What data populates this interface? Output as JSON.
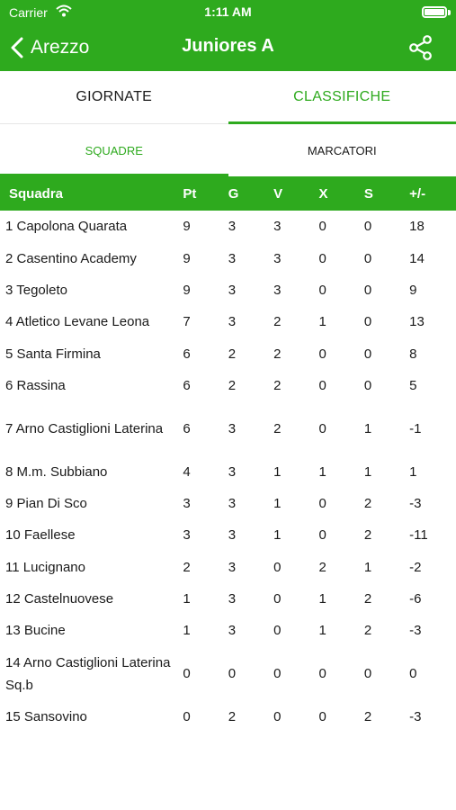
{
  "colors": {
    "accent": "#2eaa1e",
    "text": "#1a1a1a",
    "background": "#ffffff"
  },
  "status": {
    "carrier": "Carrier",
    "time": "1:11 AM"
  },
  "nav": {
    "back_label": "Arezzo",
    "title": "Juniores A",
    "share_icon": "share-icon",
    "back_icon": "chevron-left-icon"
  },
  "tabs": [
    {
      "label": "GIORNATE",
      "active": false
    },
    {
      "label": "CLASSIFICHE",
      "active": true
    }
  ],
  "subtabs": [
    {
      "label": "SQUADRE",
      "active": true
    },
    {
      "label": "MARCATORI",
      "active": false
    }
  ],
  "table": {
    "headers": [
      "Squadra",
      "Pt",
      "G",
      "V",
      "X",
      "S",
      "+/-"
    ],
    "rows": [
      {
        "team": "1  Capolona Quarata",
        "pt": "9",
        "g": "3",
        "v": "3",
        "x": "0",
        "s": "0",
        "diff": "18"
      },
      {
        "team": "2  Casentino Academy",
        "pt": "9",
        "g": "3",
        "v": "3",
        "x": "0",
        "s": "0",
        "diff": "14"
      },
      {
        "team": "3  Tegoleto",
        "pt": "9",
        "g": "3",
        "v": "3",
        "x": "0",
        "s": "0",
        "diff": "9"
      },
      {
        "team": "4  Atletico Levane Leona",
        "pt": "7",
        "g": "3",
        "v": "2",
        "x": "1",
        "s": "0",
        "diff": "13"
      },
      {
        "team": "5  Santa Firmina",
        "pt": "6",
        "g": "2",
        "v": "2",
        "x": "0",
        "s": "0",
        "diff": "8"
      },
      {
        "team": "6  Rassina",
        "pt": "6",
        "g": "2",
        "v": "2",
        "x": "0",
        "s": "0",
        "diff": "5"
      },
      {
        "team": "7  Arno Castiglioni Laterina",
        "pt": "6",
        "g": "3",
        "v": "2",
        "x": "0",
        "s": "1",
        "diff": "-1"
      },
      {
        "team": "8  M.m. Subbiano",
        "pt": "4",
        "g": "3",
        "v": "1",
        "x": "1",
        "s": "1",
        "diff": "1"
      },
      {
        "team": "9  Pian Di Sco",
        "pt": "3",
        "g": "3",
        "v": "1",
        "x": "0",
        "s": "2",
        "diff": "-3"
      },
      {
        "team": "10  Faellese",
        "pt": "3",
        "g": "3",
        "v": "1",
        "x": "0",
        "s": "2",
        "diff": "-11"
      },
      {
        "team": "11  Lucignano",
        "pt": "2",
        "g": "3",
        "v": "0",
        "x": "2",
        "s": "1",
        "diff": "-2"
      },
      {
        "team": "12  Castelnuovese",
        "pt": "1",
        "g": "3",
        "v": "0",
        "x": "1",
        "s": "2",
        "diff": "-6"
      },
      {
        "team": "13  Bucine",
        "pt": "1",
        "g": "3",
        "v": "0",
        "x": "1",
        "s": "2",
        "diff": "-3"
      },
      {
        "team": "14  Arno Castiglioni Laterina Sq.b",
        "pt": "0",
        "g": "0",
        "v": "0",
        "x": "0",
        "s": "0",
        "diff": "0"
      },
      {
        "team": "15  Sansovino",
        "pt": "0",
        "g": "2",
        "v": "0",
        "x": "0",
        "s": "2",
        "diff": "-3"
      }
    ]
  }
}
